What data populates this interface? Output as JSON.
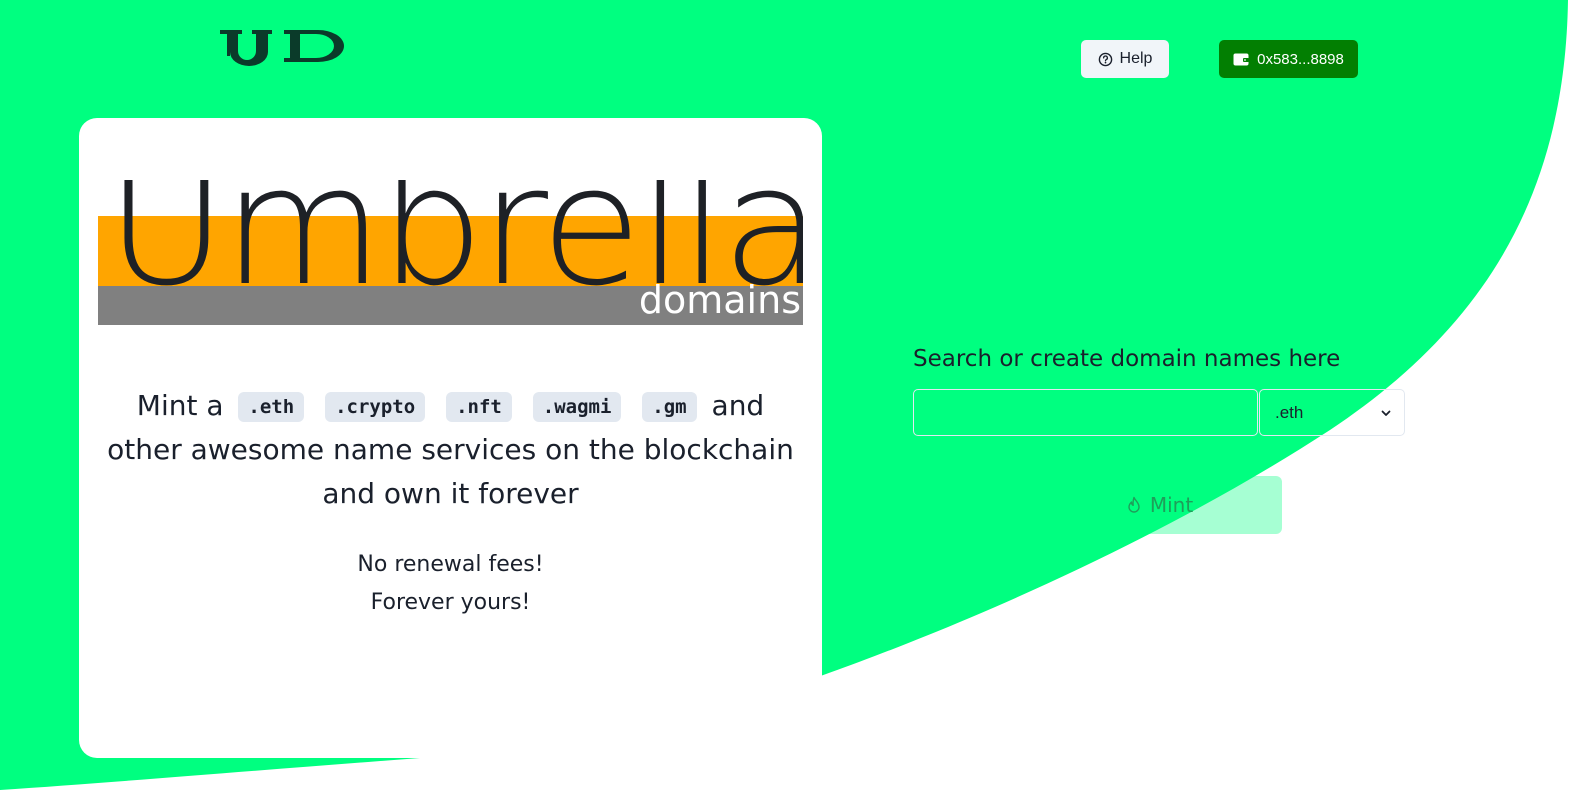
{
  "colors": {
    "brand_green": "#00ff80",
    "wallet_green": "#027f02",
    "banner_orange": "#ffa500",
    "banner_grey": "#808080",
    "text_dark": "#1a202c",
    "chip_bg": "#e2e8f0"
  },
  "header": {
    "logo_text": "UD",
    "help_label": "Help",
    "help_icon": "question-circle-icon",
    "wallet_label": "0x583...8898",
    "wallet_icon": "wallet-icon"
  },
  "card": {
    "banner": {
      "word": "Umbrella",
      "sub": "domains"
    },
    "headline": {
      "prefix": "Mint a",
      "tlds": [
        ".eth",
        ".crypto",
        ".nft",
        ".wagmi",
        ".gm"
      ],
      "suffix_1": "and",
      "line_2": "other awesome name services on the blockchain",
      "line_3": "and own it forever"
    },
    "tagline": {
      "line_1": "No renewal fees!",
      "line_2": "Forever yours!"
    }
  },
  "search": {
    "label": "Search or create domain names here",
    "input_value": "",
    "input_placeholder": "",
    "tld_selected": ".eth",
    "tld_icon": "chevron-down-icon"
  },
  "mint": {
    "label": "Mint",
    "icon": "flame-icon"
  }
}
